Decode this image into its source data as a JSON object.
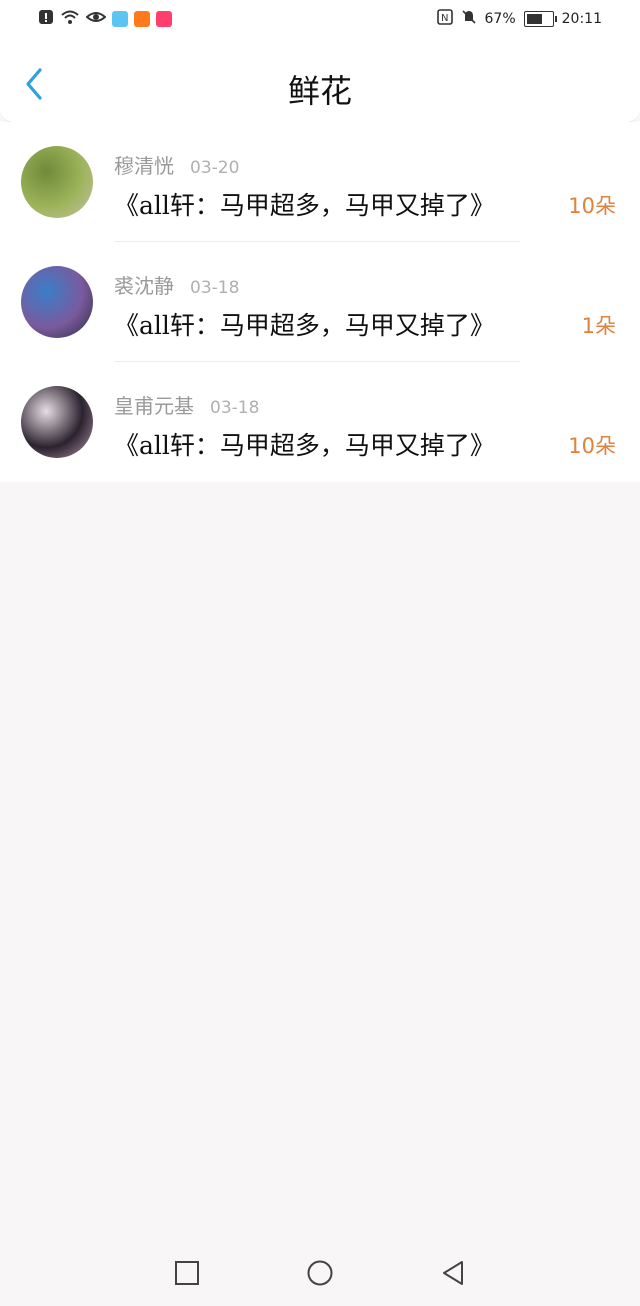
{
  "status_bar": {
    "battery": "67%",
    "time": "20:11",
    "battery_level": 0.67,
    "app_icon_colors": [
      "#5cc4f0",
      "#ff7a1a",
      "#ff3e6c"
    ]
  },
  "header": {
    "title": "鲜花",
    "back_icon": "chevron-left-icon",
    "accent": "#2f9fe3"
  },
  "list": [
    {
      "name": "穆清恍",
      "date": "03-20",
      "book": "《all轩：马甲超多，马甲又掉了》",
      "amount": "10朵",
      "avatar": [
        "#6f8a3a",
        "#9db45b",
        "#c7c1a6"
      ]
    },
    {
      "name": "裘沈静",
      "date": "03-18",
      "book": "《all轩：马甲超多，马甲又掉了》",
      "amount": "1朵",
      "avatar": [
        "#3a7ec8",
        "#7a5a9e",
        "#2b2b3d"
      ]
    },
    {
      "name": "皇甫元基",
      "date": "03-18",
      "book": "《all轩：马甲超多，马甲又掉了》",
      "amount": "10朵",
      "avatar": [
        "#e8dde3",
        "#2b2230",
        "#b79aa8"
      ]
    }
  ],
  "nav": {
    "recents": "square-icon",
    "home": "circle-icon",
    "back": "triangle-back-icon"
  }
}
